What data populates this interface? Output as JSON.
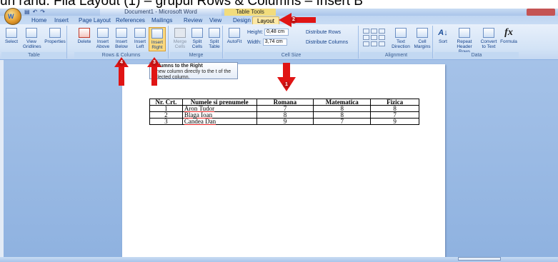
{
  "caption": "un rand: Fila Layout (1) – grupul Rows & Columns – Insert B",
  "titlebar": {
    "office_button": "W",
    "qat": [
      "▤",
      "↶",
      "↷"
    ],
    "title": "Document1 - Microsoft Word",
    "contextual": "Table Tools"
  },
  "tabs": [
    "Home",
    "Insert",
    "Page Layout",
    "References",
    "Mailings",
    "Review",
    "View",
    "Design",
    "Layout"
  ],
  "ribbon": {
    "table_group": {
      "label": "Table",
      "buttons": [
        "Select",
        "View Gridlines",
        "Properties"
      ]
    },
    "rows_columns": {
      "label": "Rows & Columns",
      "buttons": [
        "Delete",
        "Insert Above",
        "Insert Below",
        "Insert Left",
        "Insert Right"
      ]
    },
    "merge": {
      "label": "Merge",
      "buttons": [
        "Merge Cells",
        "Split Cells",
        "Split Table"
      ]
    },
    "cell_size": {
      "label": "Cell Size",
      "autofit": "AutoFit",
      "height_label": "Height:",
      "height_value": "0,48 cm",
      "width_label": "Width:",
      "width_value": "3,74 cm",
      "distribute_rows": "Distribute Rows",
      "distribute_columns": "Distribute Columns"
    },
    "alignment": {
      "label": "Alignment",
      "buttons": [
        "Text Direction",
        "Cell Margins"
      ]
    },
    "data": {
      "label": "Data",
      "buttons": [
        "Sort",
        "Repeat Header Rows",
        "Convert to Text",
        "Formula"
      ]
    }
  },
  "tooltip": {
    "title": "Columns to the Right",
    "body": "a new column directly to the t of the selected column."
  },
  "table": {
    "headers": [
      "Nr. Crt.",
      "Numele si prenumele",
      "Romana",
      "Matematica",
      "Fizica"
    ],
    "rows": [
      [
        "1",
        "Aron Tudor",
        "7",
        "8",
        "8"
      ],
      [
        "2",
        "Blaga Ioan",
        "8",
        "8",
        "7"
      ],
      [
        "3",
        "Candea Dan",
        "9",
        "7",
        "9"
      ]
    ]
  },
  "annotations": [
    "1",
    "2",
    "3",
    "4"
  ],
  "colors": {
    "arrow": "#e01414",
    "badge": "#c31212",
    "active_tab": "#fbe8a7",
    "workspace": "#9dbbe5"
  }
}
